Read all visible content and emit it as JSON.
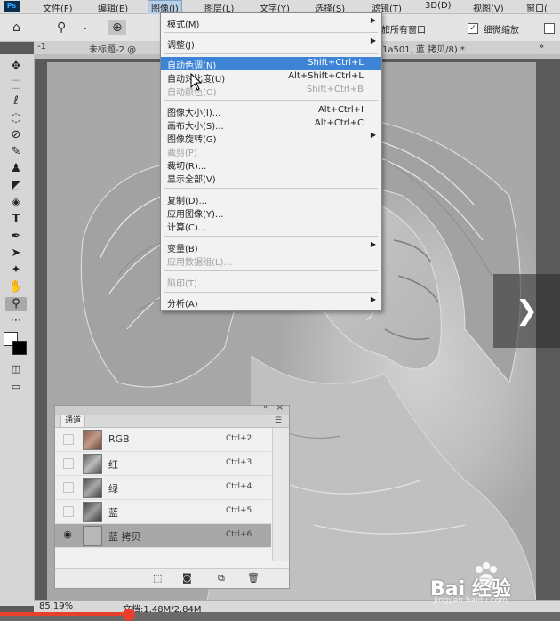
{
  "menubar": {
    "logo": "Ps",
    "items": [
      "文件(F)",
      "编辑(E)",
      "图像(I)",
      "图层(L)",
      "文字(Y)",
      "选择(S)",
      "滤镜(T)",
      "3D(D)",
      "视图(V)",
      "窗口("
    ]
  },
  "options": {
    "all_windows": "旅所有窗口",
    "scrubby": "细微缩放"
  },
  "tabs": {
    "tab1": "-1",
    "tab2": "未标题-2 @",
    "tab3": "1a501, 蓝 拷贝/8) *",
    "more": "»"
  },
  "dropdown": {
    "items": [
      {
        "label": "模式(M)",
        "shortcut": "",
        "submenu": true
      },
      {
        "label": "调整(J)",
        "shortcut": "",
        "submenu": true
      },
      {
        "label": "自动色调(N)",
        "shortcut": "Shift+Ctrl+L"
      },
      {
        "label": "自动对比度(U)",
        "shortcut": "Alt+Shift+Ctrl+L"
      },
      {
        "label": "自动颜色(O)",
        "shortcut": "Shift+Ctrl+B"
      },
      {
        "label": "图像大小(I)...",
        "shortcut": "Alt+Ctrl+I"
      },
      {
        "label": "画布大小(S)...",
        "shortcut": "Alt+Ctrl+C"
      },
      {
        "label": "图像旋转(G)",
        "shortcut": "",
        "submenu": true
      },
      {
        "label": "裁剪(P)",
        "shortcut": ""
      },
      {
        "label": "裁切(R)...",
        "shortcut": ""
      },
      {
        "label": "显示全部(V)",
        "shortcut": ""
      },
      {
        "label": "复制(D)...",
        "shortcut": ""
      },
      {
        "label": "应用图像(Y)...",
        "shortcut": ""
      },
      {
        "label": "计算(C)...",
        "shortcut": ""
      },
      {
        "label": "变量(B)",
        "shortcut": "",
        "submenu": true
      },
      {
        "label": "应用数据组(L)...",
        "shortcut": ""
      },
      {
        "label": "陷印(T)...",
        "shortcut": ""
      },
      {
        "label": "分析(A)",
        "shortcut": "",
        "submenu": true
      }
    ]
  },
  "channels": {
    "tab": "通道",
    "rows": [
      {
        "name": "RGB",
        "shortcut": "Ctrl+2"
      },
      {
        "name": "红",
        "shortcut": "Ctrl+3"
      },
      {
        "name": "绿",
        "shortcut": "Ctrl+4"
      },
      {
        "name": "蓝",
        "shortcut": "Ctrl+5"
      },
      {
        "name": "蓝 拷贝",
        "shortcut": "Ctrl+6"
      }
    ]
  },
  "status": {
    "zoom": "85.19%",
    "doc": "文档:1.48M/2.84M"
  },
  "video_progress": 0.23,
  "watermark": {
    "brand": "Bai 经验",
    "url": "jingyan.baidu.com"
  },
  "colors": {
    "highlight": "#3d83d6",
    "progress": "#e8402d"
  }
}
